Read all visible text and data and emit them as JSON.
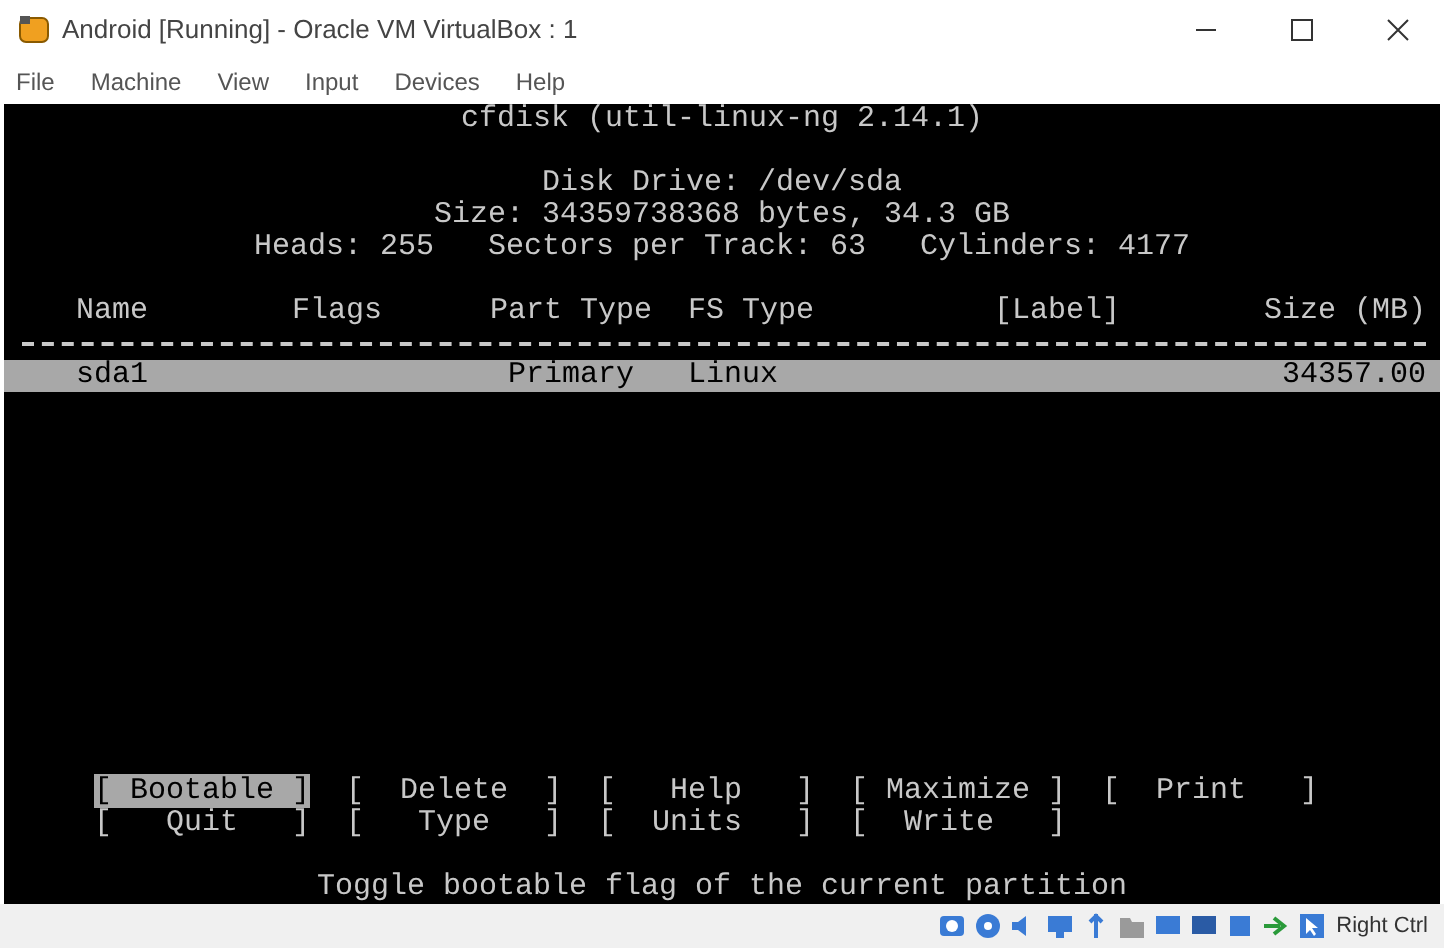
{
  "window": {
    "title": "Android [Running] - Oracle VM VirtualBox : 1"
  },
  "menu": [
    "File",
    "Machine",
    "View",
    "Input",
    "Devices",
    "Help"
  ],
  "terminal": {
    "title": "cfdisk (util-linux-ng 2.14.1)",
    "disk_info": [
      "Disk Drive: /dev/sda",
      "Size: 34359738368 bytes, 34.3 GB",
      "Heads: 255   Sectors per Track: 63   Cylinders: 4177"
    ],
    "table": {
      "columns": [
        "Name",
        "Flags",
        "Part Type",
        "FS Type",
        "[Label]",
        "Size (MB)"
      ],
      "rows": [
        {
          "name": "sda1",
          "part_type": "Primary",
          "fs_type": "Linux",
          "size": "34357.00",
          "selected": true
        }
      ]
    },
    "commands": [
      [
        {
          "label": "[ Bootable ]",
          "selected": true
        },
        {
          "label": "[  Delete  ]",
          "selected": false
        },
        {
          "label": "[   Help   ]",
          "selected": false
        },
        {
          "label": "[ Maximize ]",
          "selected": false
        },
        {
          "label": "[  Print   ]",
          "selected": false
        }
      ],
      [
        {
          "label": "[   Quit   ]",
          "selected": false
        },
        {
          "label": "[   Type   ]",
          "selected": false
        },
        {
          "label": "[  Units   ]",
          "selected": false
        },
        {
          "label": "[  Write   ]",
          "selected": false
        }
      ]
    ],
    "help_text": "Toggle bootable flag of the current partition"
  },
  "status_bar": {
    "host_key": "Right Ctrl"
  }
}
